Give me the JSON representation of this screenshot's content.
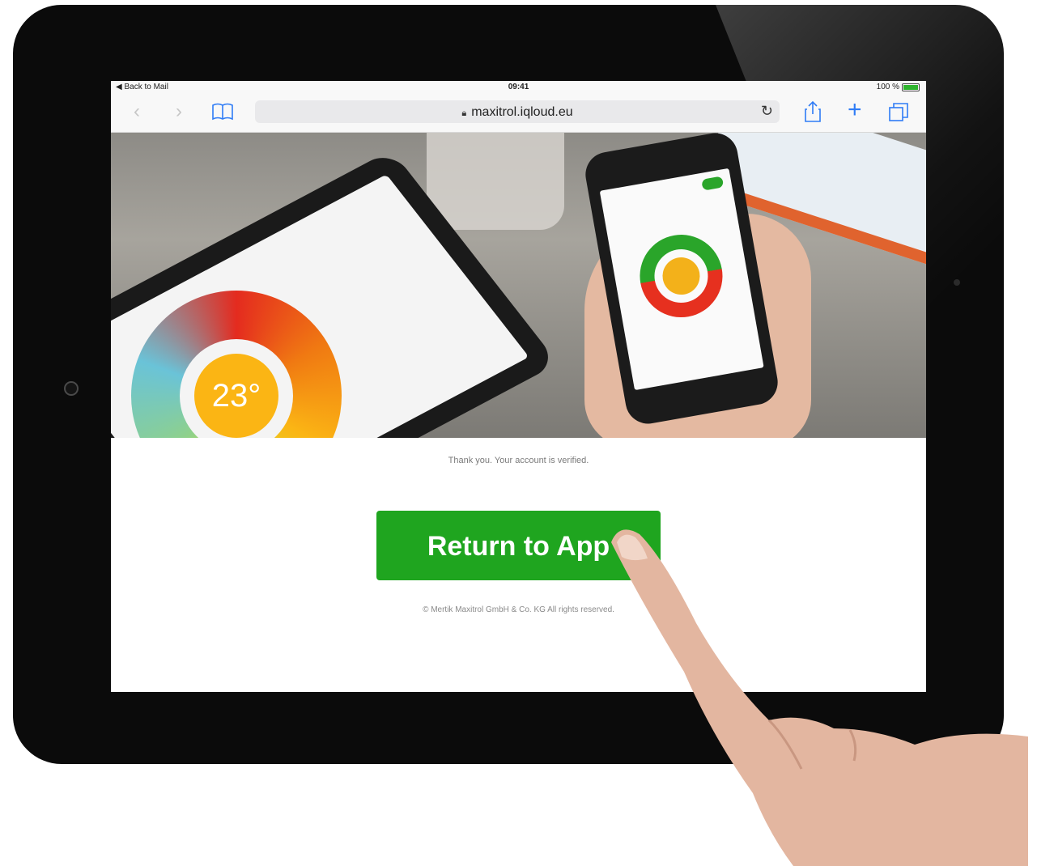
{
  "status_bar": {
    "back_label": "◀ Back to Mail",
    "time": "09:41",
    "battery": "100 %"
  },
  "browser": {
    "url": "maxitrol.iqloud.eu"
  },
  "hero_image": {
    "tablet_display_temp": "23°"
  },
  "content": {
    "verified_message": "Thank you. Your account is verified.",
    "cta_label": "Return to App",
    "copyright": "© Mertik Maxitrol GmbH & Co. KG All rights reserved."
  },
  "colors": {
    "cta": "#1fa51f",
    "ios_blue": "#2f7cf6"
  }
}
